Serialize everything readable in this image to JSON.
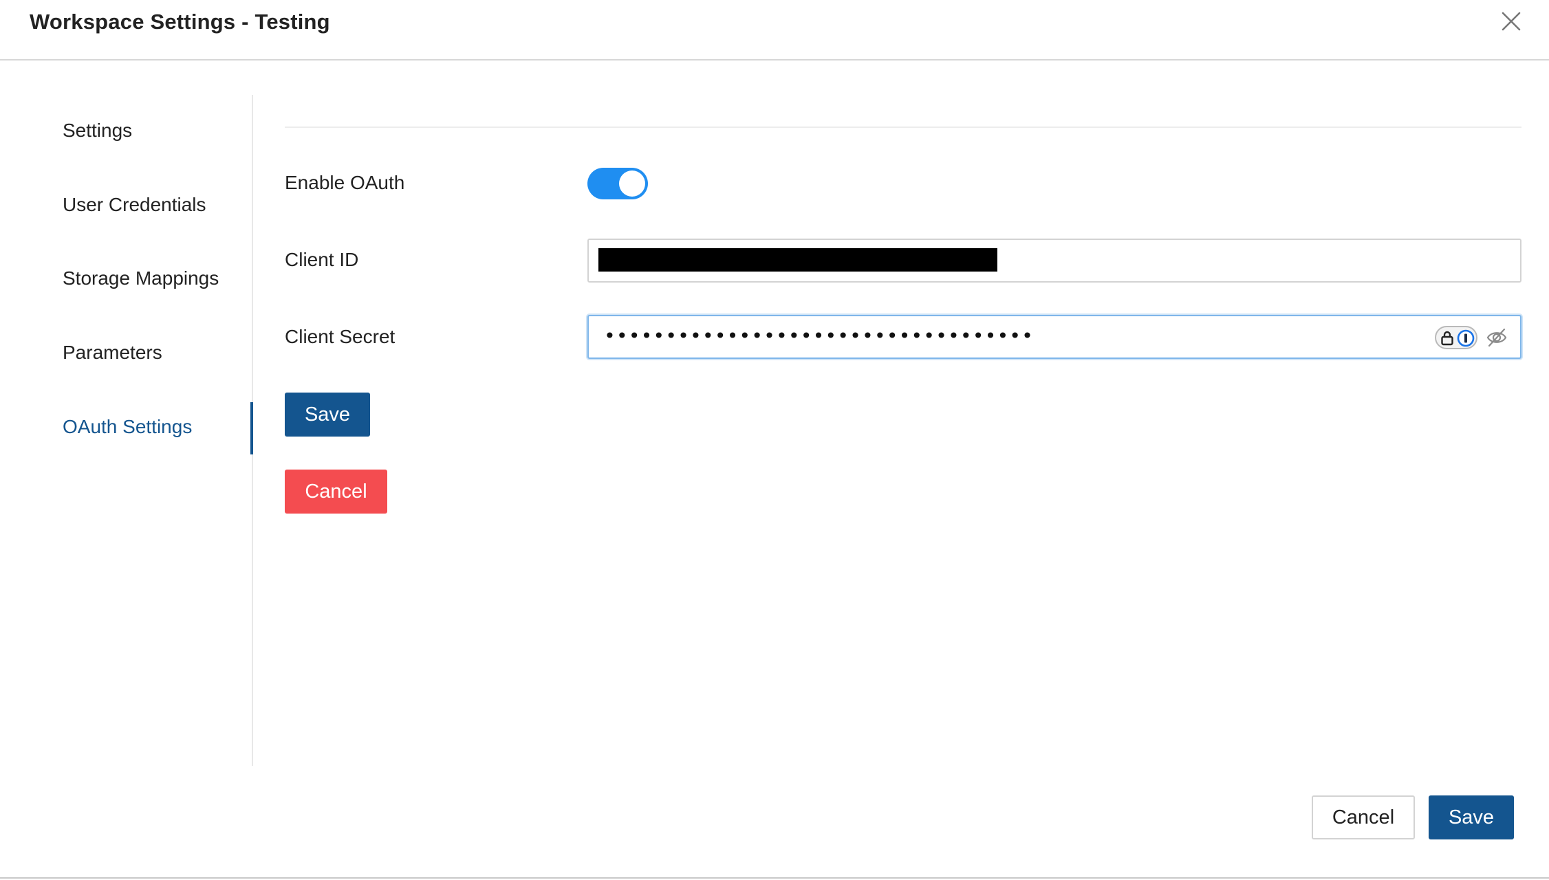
{
  "dialog": {
    "title": "Workspace Settings - Testing"
  },
  "sidebar": {
    "items": [
      {
        "label": "Settings"
      },
      {
        "label": "User Credentials"
      },
      {
        "label": "Storage Mappings"
      },
      {
        "label": "Parameters"
      },
      {
        "label": "OAuth Settings",
        "active": true
      }
    ]
  },
  "form": {
    "enable_oauth_label": "Enable OAuth",
    "enable_oauth_value": true,
    "client_id_label": "Client ID",
    "client_id_value": "[redacted]",
    "client_secret_label": "Client Secret",
    "client_secret_value": "•••••••••••••••••••••••••••••••••••",
    "save_label": "Save",
    "cancel_label": "Cancel"
  },
  "footer": {
    "cancel_label": "Cancel",
    "save_label": "Save"
  },
  "colors": {
    "primary": "#14558f",
    "toggle_on": "#1f8ef1",
    "danger": "#f44c50"
  },
  "icons": [
    "close-icon",
    "lock-icon",
    "password-manager-icon",
    "eye-off-icon"
  ]
}
